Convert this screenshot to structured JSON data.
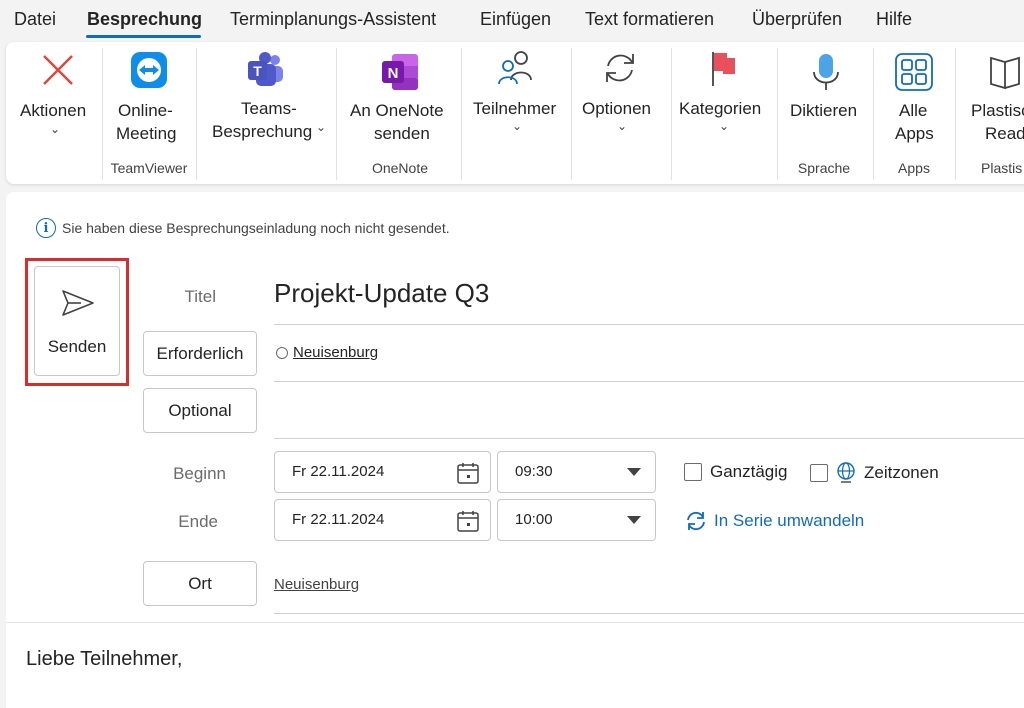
{
  "menu": {
    "items": [
      "Datei",
      "Besprechung",
      "Terminplanungs-Assistent",
      "Einfügen",
      "Text formatieren",
      "Überprüfen",
      "Hilfe"
    ]
  },
  "ribbon": {
    "aktionen": {
      "label": "Aktionen"
    },
    "online_meeting": {
      "label1": "Online-",
      "label2": "Meeting",
      "group": "TeamViewer"
    },
    "teams": {
      "label1": "Teams-",
      "label2": "Besprechung"
    },
    "onenote": {
      "label1": "An OneNote",
      "label2": "senden",
      "group": "OneNote"
    },
    "teilnehmer": {
      "label": "Teilnehmer"
    },
    "optionen": {
      "label": "Optionen"
    },
    "kategorien": {
      "label": "Kategorien"
    },
    "diktieren": {
      "label": "Diktieren",
      "group": "Sprache"
    },
    "alle_apps": {
      "label1": "Alle",
      "label2": "Apps",
      "group": "Apps"
    },
    "plastisch": {
      "label1": "Plastisc",
      "label2": "Reade",
      "group": "Plastis"
    }
  },
  "info": {
    "text": "Sie haben diese Besprechungseinladung noch nicht gesendet."
  },
  "send": {
    "label": "Senden"
  },
  "form": {
    "title_label": "Titel",
    "title_value": "Projekt-Update Q3",
    "required_button": "Erforderlich",
    "required_attendee": "Neuisenburg",
    "optional_button": "Optional",
    "start_label": "Beginn",
    "start_date": "Fr 22.11.2024",
    "start_time": "09:30",
    "end_label": "Ende",
    "end_date": "Fr 22.11.2024",
    "end_time": "10:00",
    "allday_label": "Ganztägig",
    "timezones_label": "Zeitzonen",
    "series_label": "In Serie umwandeln",
    "location_button": "Ort",
    "location_value": "Neuisenburg"
  },
  "body": {
    "text": "Liebe Teilnehmer,"
  },
  "colors": {
    "accent": "#0f6cbd",
    "highlight": "#d92c2c"
  }
}
